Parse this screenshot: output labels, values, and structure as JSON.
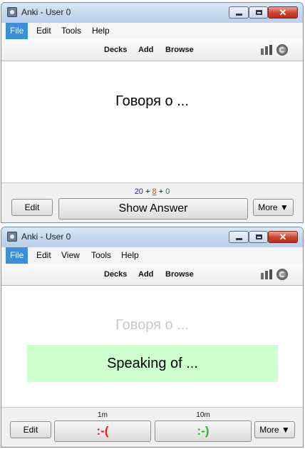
{
  "windows": [
    {
      "title": "Anki - User 0",
      "menu": [
        {
          "label": "File",
          "active": true
        },
        {
          "label": "Edit"
        },
        {
          "label": "Tools"
        },
        {
          "label": "Help"
        }
      ],
      "toolbar": {
        "links": [
          "Decks",
          "Add",
          "Browse"
        ],
        "icons": [
          "stats-icon",
          "sync-icon"
        ]
      },
      "card": {
        "question": "Говоря о ..."
      },
      "counts": {
        "new": "20",
        "plus1": "+",
        "learn": "8",
        "plus2": "+",
        "review": "0"
      },
      "buttons": {
        "edit": "Edit",
        "show_answer": "Show Answer",
        "more": "More ▼"
      }
    },
    {
      "title": "Anki - User 0",
      "menu": [
        {
          "label": "File",
          "active": true
        },
        {
          "label": "Edit"
        },
        {
          "label": "View"
        },
        {
          "label": "Tools"
        },
        {
          "label": "Help"
        }
      ],
      "toolbar": {
        "links": [
          "Decks",
          "Add",
          "Browse"
        ],
        "icons": [
          "stats-icon",
          "sync-icon"
        ]
      },
      "card": {
        "question": "Говоря о ...",
        "answer": "Speaking of ...",
        "answer_bg": "#ccffcc"
      },
      "answer_buttons": [
        {
          "time": "1m",
          "label": ":-(",
          "color": "#e02020"
        },
        {
          "time": "10m",
          "label": ":-)",
          "color": "#22b822"
        }
      ],
      "buttons": {
        "edit": "Edit",
        "more": "More ▼"
      }
    }
  ],
  "colors": {
    "menu_highlight": "#3c8fd8",
    "close_button": "#c9422d"
  }
}
